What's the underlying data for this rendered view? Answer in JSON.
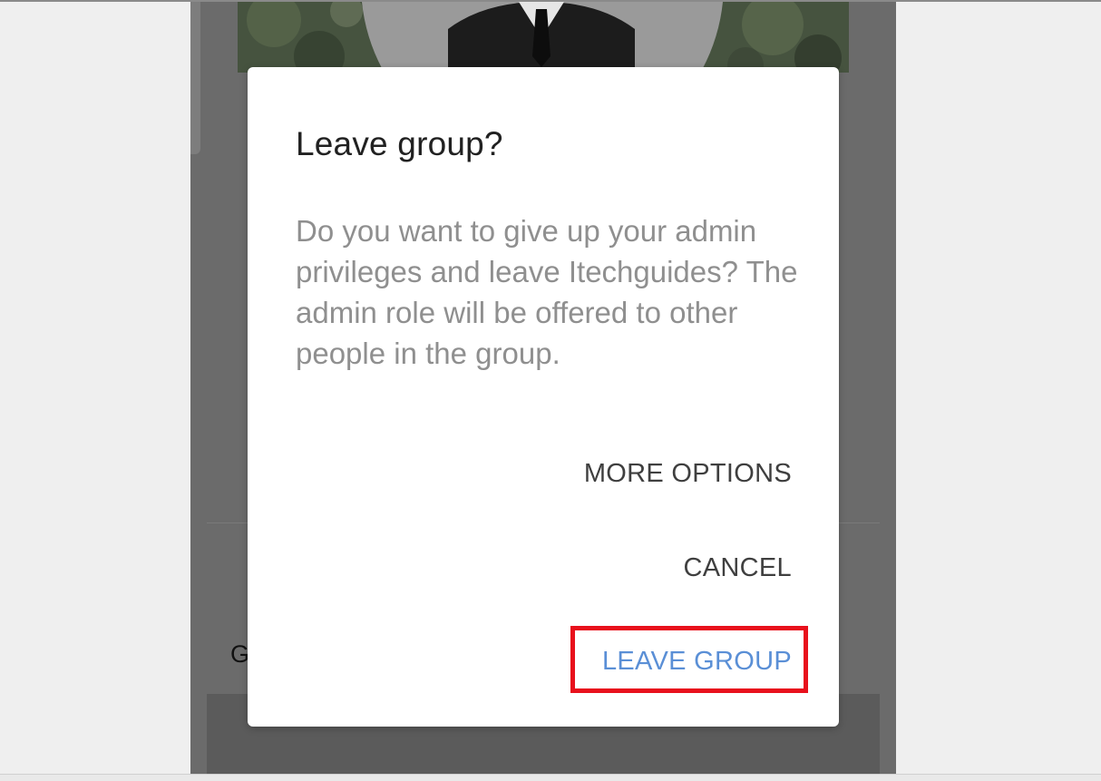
{
  "dialog": {
    "title": "Leave group?",
    "message": "Do you want to give up your admin privileges and leave Itechguides? The admin role will be offered to other people in the group.",
    "buttons": {
      "more_options": "MORE OPTIONS",
      "cancel": "CANCEL",
      "leave_group": "LEAVE GROUP"
    }
  },
  "background": {
    "partial_label": "G"
  },
  "colors": {
    "accent": "#5a8fd6",
    "highlight": "#e8101c",
    "scrim": "#6b6b6b"
  }
}
